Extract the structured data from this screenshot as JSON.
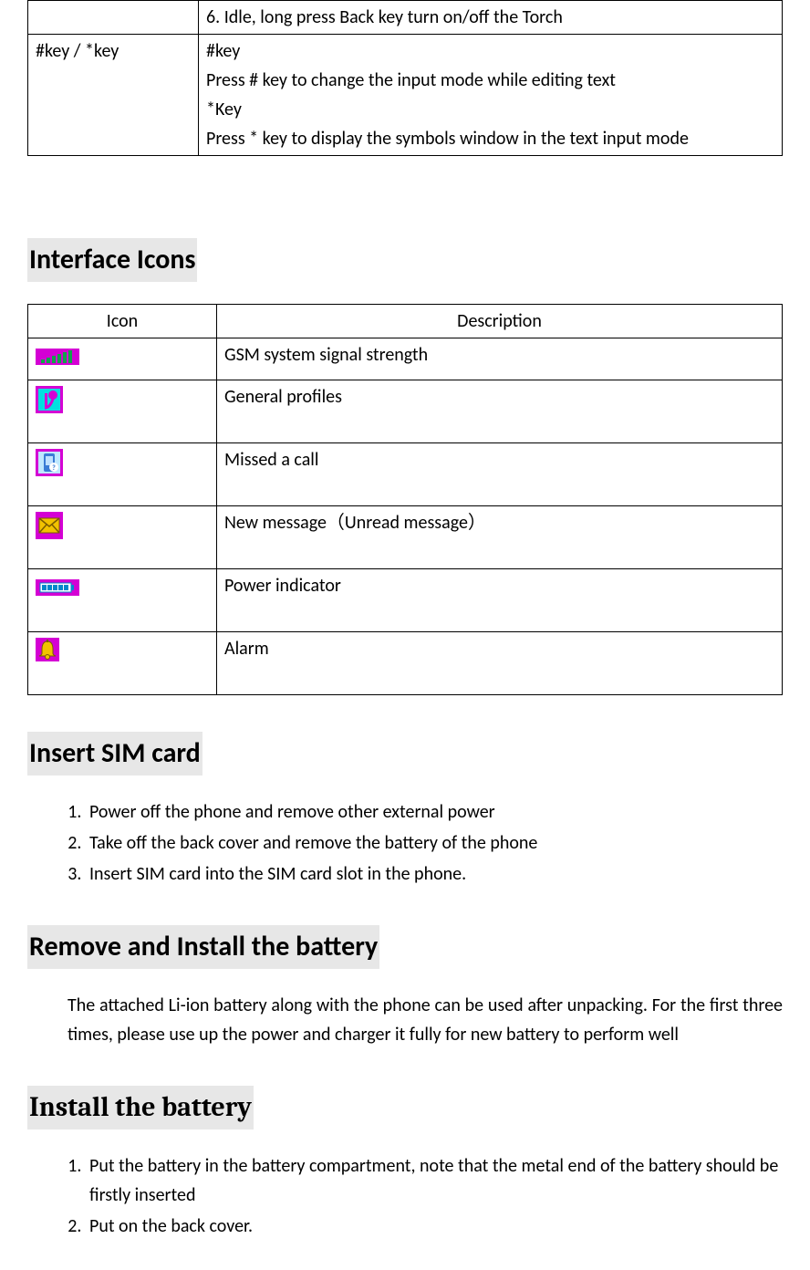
{
  "keytable": {
    "row1": {
      "col1": "",
      "col2": "6.    Idle, long press Back key    turn on/off the Torch"
    },
    "row2": {
      "col1": "#key / *key",
      "line1": "#key",
      "line2": "Press # key to change the input mode while editing text",
      "line3": "*Key",
      "line4": "Press * key to display the symbols window in the text input mode"
    }
  },
  "sections": {
    "interface_icons": "Interface Icons",
    "insert_sim": "Insert SIM card",
    "remove_install_batt": "Remove and Install the battery",
    "install_batt": "Install the battery"
  },
  "icon_table": {
    "header": {
      "icon": "Icon",
      "desc": "Description"
    },
    "rows": [
      {
        "key": "signal",
        "desc": "GSM system signal strength"
      },
      {
        "key": "profile",
        "desc": "General profiles"
      },
      {
        "key": "missed",
        "desc": "Missed a call"
      },
      {
        "key": "message",
        "desc": "New message（Unread message）"
      },
      {
        "key": "power",
        "desc": "Power indicator"
      },
      {
        "key": "alarm",
        "desc": "Alarm"
      }
    ]
  },
  "insert_sim_list": [
    "Power off the phone and remove other external power",
    "Take off the back cover and remove the battery of the phone",
    "Insert SIM card into the SIM card slot in the phone."
  ],
  "remove_install_para": "The attached Li-ion battery along with the phone can be used after unpacking. For the first three times, please use up the power and charger it fully for new battery to perform well",
  "install_batt_list": [
    "Put the battery in the battery compartment, note that the metal end of the battery should be firstly inserted",
    "Put on the back cover."
  ]
}
